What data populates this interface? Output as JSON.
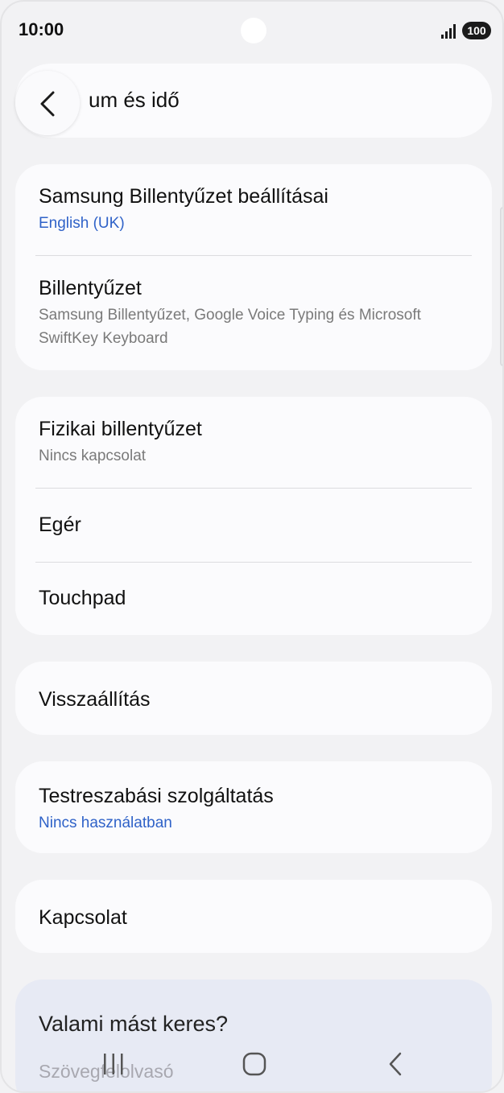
{
  "status_bar": {
    "time": "10:00",
    "battery": "100",
    "icons": [
      "signal-icon",
      "battery-icon",
      "camera-hole"
    ]
  },
  "header": {
    "title": "um és idő",
    "back_icon": "chevron-left-icon"
  },
  "groups": [
    {
      "items": [
        {
          "title": "Samsung Billentyűzet beállításai",
          "subtitle": "English (UK)"
        },
        {
          "title": "Billentyűzet",
          "subtitle": "Samsung Billentyűzet, Google Voice Typing és Microsoft SwiftKey Keyboard"
        }
      ]
    },
    {
      "items": [
        {
          "title": "Fizikai billentyűzet",
          "subtitle": "Nincs kapcsolat"
        },
        {
          "title": "Egér"
        },
        {
          "title": "Touchpad"
        }
      ]
    },
    {
      "items": [
        {
          "title": "Visszaállítás"
        }
      ]
    },
    {
      "items": [
        {
          "title": "Testreszabási szolgáltatás",
          "subtitle": "Nincs használatban"
        }
      ]
    },
    {
      "items": [
        {
          "title": "Kapcsolat"
        }
      ]
    }
  ],
  "suggestions": {
    "title": "Valami mást keres?",
    "item": "Szövegfelolvasó"
  },
  "navbar": {
    "icons": [
      "recent-apps-icon",
      "home-icon",
      "back-icon"
    ]
  },
  "colors": {
    "background": "#f2f2f4",
    "card": "#fbfbfd",
    "accent": "#2f62c8",
    "secondary_text": "#7a7a7a",
    "suggest_card": "#e7eaf4"
  }
}
